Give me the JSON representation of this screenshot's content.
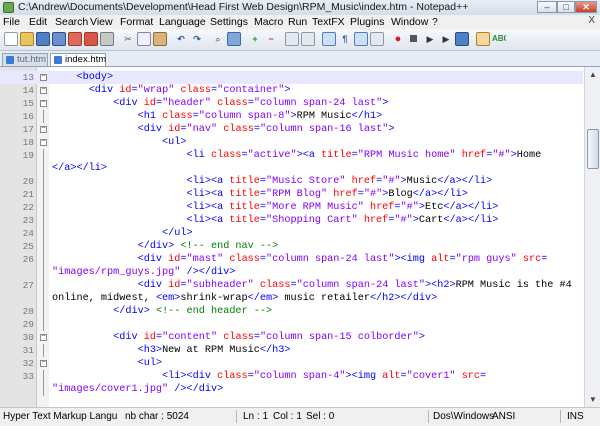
{
  "window": {
    "title": "C:\\Andrew\\Documents\\Development\\Head First Web Design\\RPM_Music\\index.htm - Notepad++",
    "min": "–",
    "max": "□",
    "close": "✕"
  },
  "menu": [
    "File",
    "Edit",
    "Search",
    "View",
    "Format",
    "Language",
    "Settings",
    "Macro",
    "Run",
    "TextFX",
    "Plugins",
    "Window",
    "?"
  ],
  "menu_close": "X",
  "toolbar": {
    "icons": [
      "new-file-icon",
      "open-file-icon",
      "save-icon",
      "save-all-icon",
      "close-icon",
      "close-all-icon",
      "print-icon",
      "cut-icon",
      "copy-icon",
      "paste-icon",
      "undo-icon",
      "redo-icon",
      "find-icon",
      "replace-icon",
      "zoom-in-icon",
      "zoom-out-icon",
      "sync-v-icon",
      "sync-h-icon",
      "wrap-icon",
      "all-chars-icon",
      "indent-guide-icon",
      "user-lang-icon",
      "record-macro-icon",
      "stop-record-icon",
      "play-macro-icon",
      "run-macro-multi-icon",
      "save-macro-icon",
      "tidy-icon",
      "spellcheck-icon"
    ]
  },
  "tabs": [
    {
      "label": "tut.htm"
    },
    {
      "label": "index.htm"
    }
  ],
  "editor": {
    "lines": [
      {
        "num": "13",
        "segs": [
          [
            "x",
            "    "
          ],
          [
            "t",
            "<body>"
          ]
        ]
      },
      {
        "num": "14",
        "segs": [
          [
            "x",
            "      "
          ],
          [
            "t",
            "<div "
          ],
          [
            "a",
            "id"
          ],
          [
            "t",
            "="
          ],
          [
            "s",
            "\"wrap\""
          ],
          [
            "t",
            " "
          ],
          [
            "a",
            "class"
          ],
          [
            "t",
            "="
          ],
          [
            "s",
            "\"container\""
          ],
          [
            "t",
            ">"
          ]
        ]
      },
      {
        "num": "15",
        "segs": [
          [
            "x",
            "          "
          ],
          [
            "t",
            "<div "
          ],
          [
            "a",
            "id"
          ],
          [
            "t",
            "="
          ],
          [
            "s",
            "\"header\""
          ],
          [
            "t",
            " "
          ],
          [
            "a",
            "class"
          ],
          [
            "t",
            "="
          ],
          [
            "s",
            "\"column span-24 last\""
          ],
          [
            "t",
            ">"
          ]
        ]
      },
      {
        "num": "16",
        "segs": [
          [
            "x",
            "              "
          ],
          [
            "t",
            "<h1 "
          ],
          [
            "a",
            "class"
          ],
          [
            "t",
            "="
          ],
          [
            "s",
            "\"column span-8\""
          ],
          [
            "t",
            ">"
          ],
          [
            "x",
            "RPM Music"
          ],
          [
            "t",
            "</h1>"
          ]
        ]
      },
      {
        "num": "17",
        "segs": [
          [
            "x",
            "              "
          ],
          [
            "t",
            "<div "
          ],
          [
            "a",
            "id"
          ],
          [
            "t",
            "="
          ],
          [
            "s",
            "\"nav\""
          ],
          [
            "t",
            " "
          ],
          [
            "a",
            "class"
          ],
          [
            "t",
            "="
          ],
          [
            "s",
            "\"column span-16 last\""
          ],
          [
            "t",
            ">"
          ]
        ]
      },
      {
        "num": "18",
        "segs": [
          [
            "x",
            "                  "
          ],
          [
            "t",
            "<ul>"
          ]
        ]
      },
      {
        "num": "19",
        "segs": [
          [
            "x",
            "                      "
          ],
          [
            "t",
            "<li "
          ],
          [
            "a",
            "class"
          ],
          [
            "t",
            "="
          ],
          [
            "s",
            "\"active\""
          ],
          [
            "t",
            "><a "
          ],
          [
            "a",
            "title"
          ],
          [
            "t",
            "="
          ],
          [
            "s",
            "\"RPM Music home\""
          ],
          [
            "t",
            " "
          ],
          [
            "a",
            "href"
          ],
          [
            "t",
            "="
          ],
          [
            "s",
            "\"#\""
          ],
          [
            "t",
            ">"
          ],
          [
            "x",
            "Home"
          ]
        ]
      },
      {
        "num": "",
        "segs": [
          [
            "t",
            "</a></li>"
          ]
        ]
      },
      {
        "num": "20",
        "segs": [
          [
            "x",
            "                      "
          ],
          [
            "t",
            "<li><a "
          ],
          [
            "a",
            "title"
          ],
          [
            "t",
            "="
          ],
          [
            "s",
            "\"Music Store\""
          ],
          [
            "t",
            " "
          ],
          [
            "a",
            "href"
          ],
          [
            "t",
            "="
          ],
          [
            "s",
            "\"#\""
          ],
          [
            "t",
            ">"
          ],
          [
            "x",
            "Music"
          ],
          [
            "t",
            "</a></li>"
          ]
        ]
      },
      {
        "num": "21",
        "segs": [
          [
            "x",
            "                      "
          ],
          [
            "t",
            "<li><a "
          ],
          [
            "a",
            "title"
          ],
          [
            "t",
            "="
          ],
          [
            "s",
            "\"RPM Blog\""
          ],
          [
            "t",
            " "
          ],
          [
            "a",
            "href"
          ],
          [
            "t",
            "="
          ],
          [
            "s",
            "\"#\""
          ],
          [
            "t",
            ">"
          ],
          [
            "x",
            "Blog"
          ],
          [
            "t",
            "</a></li>"
          ]
        ]
      },
      {
        "num": "22",
        "segs": [
          [
            "x",
            "                      "
          ],
          [
            "t",
            "<li><a "
          ],
          [
            "a",
            "title"
          ],
          [
            "t",
            "="
          ],
          [
            "s",
            "\"More RPM Music\""
          ],
          [
            "t",
            " "
          ],
          [
            "a",
            "href"
          ],
          [
            "t",
            "="
          ],
          [
            "s",
            "\"#\""
          ],
          [
            "t",
            ">"
          ],
          [
            "x",
            "Etc"
          ],
          [
            "t",
            "</a></li>"
          ]
        ]
      },
      {
        "num": "23",
        "segs": [
          [
            "x",
            "                      "
          ],
          [
            "t",
            "<li><a "
          ],
          [
            "a",
            "title"
          ],
          [
            "t",
            "="
          ],
          [
            "s",
            "\"Shopping Cart\""
          ],
          [
            "t",
            " "
          ],
          [
            "a",
            "href"
          ],
          [
            "t",
            "="
          ],
          [
            "s",
            "\"#\""
          ],
          [
            "t",
            ">"
          ],
          [
            "x",
            "Cart"
          ],
          [
            "t",
            "</a></li>"
          ]
        ]
      },
      {
        "num": "24",
        "segs": [
          [
            "x",
            "                  "
          ],
          [
            "t",
            "</ul>"
          ]
        ]
      },
      {
        "num": "25",
        "segs": [
          [
            "x",
            "              "
          ],
          [
            "t",
            "</div>"
          ],
          [
            "x",
            " "
          ],
          [
            "c",
            "<!-- end nav -->"
          ]
        ]
      },
      {
        "num": "26",
        "segs": [
          [
            "x",
            "              "
          ],
          [
            "t",
            "<div "
          ],
          [
            "a",
            "id"
          ],
          [
            "t",
            "="
          ],
          [
            "s",
            "\"mast\""
          ],
          [
            "t",
            " "
          ],
          [
            "a",
            "class"
          ],
          [
            "t",
            "="
          ],
          [
            "s",
            "\"column span-24 last\""
          ],
          [
            "t",
            "><img "
          ],
          [
            "a",
            "alt"
          ],
          [
            "t",
            "="
          ],
          [
            "s",
            "\"rpm guys\""
          ],
          [
            "t",
            " "
          ],
          [
            "a",
            "src"
          ],
          [
            "t",
            "="
          ]
        ]
      },
      {
        "num": "",
        "segs": [
          [
            "s",
            "\"images/rpm_guys.jpg\""
          ],
          [
            "t",
            " /></div>"
          ]
        ]
      },
      {
        "num": "27",
        "segs": [
          [
            "x",
            "              "
          ],
          [
            "t",
            "<div "
          ],
          [
            "a",
            "id"
          ],
          [
            "t",
            "="
          ],
          [
            "s",
            "\"subheader\""
          ],
          [
            "t",
            " "
          ],
          [
            "a",
            "class"
          ],
          [
            "t",
            "="
          ],
          [
            "s",
            "\"column span-24 last\""
          ],
          [
            "t",
            "><h2>"
          ],
          [
            "x",
            "RPM Music is the #4"
          ]
        ]
      },
      {
        "num": "",
        "segs": [
          [
            "x",
            "online, midwest, "
          ],
          [
            "t",
            "<em>"
          ],
          [
            "x",
            "shrink-wrap"
          ],
          [
            "t",
            "</em>"
          ],
          [
            "x",
            " music retailer"
          ],
          [
            "t",
            "</h2></div>"
          ]
        ]
      },
      {
        "num": "28",
        "segs": [
          [
            "x",
            "          "
          ],
          [
            "t",
            "</div>"
          ],
          [
            "x",
            " "
          ],
          [
            "c",
            "<!-- end header -->"
          ]
        ]
      },
      {
        "num": "29",
        "segs": [
          [
            "x",
            ""
          ]
        ]
      },
      {
        "num": "30",
        "segs": [
          [
            "x",
            "          "
          ],
          [
            "t",
            "<div "
          ],
          [
            "a",
            "id"
          ],
          [
            "t",
            "="
          ],
          [
            "s",
            "\"content\""
          ],
          [
            "t",
            " "
          ],
          [
            "a",
            "class"
          ],
          [
            "t",
            "="
          ],
          [
            "s",
            "\"column span-15 colborder\""
          ],
          [
            "t",
            ">"
          ]
        ]
      },
      {
        "num": "31",
        "segs": [
          [
            "x",
            "              "
          ],
          [
            "t",
            "<h3>"
          ],
          [
            "x",
            "New at RPM Music"
          ],
          [
            "t",
            "</h3>"
          ]
        ]
      },
      {
        "num": "32",
        "segs": [
          [
            "x",
            "              "
          ],
          [
            "t",
            "<ul>"
          ]
        ]
      },
      {
        "num": "33",
        "segs": [
          [
            "x",
            "                  "
          ],
          [
            "t",
            "<li><div "
          ],
          [
            "a",
            "class"
          ],
          [
            "t",
            "="
          ],
          [
            "s",
            "\"column span-4\""
          ],
          [
            "t",
            "><img "
          ],
          [
            "a",
            "alt"
          ],
          [
            "t",
            "="
          ],
          [
            "s",
            "\"cover1\""
          ],
          [
            "t",
            " "
          ],
          [
            "a",
            "src"
          ],
          [
            "t",
            "="
          ]
        ]
      },
      {
        "num": "",
        "segs": [
          [
            "s",
            "\"images/cover1.jpg\""
          ],
          [
            "t",
            " /></div>"
          ]
        ]
      }
    ]
  },
  "status": {
    "language": "Hyper Text Markup Langu",
    "chars": "nb char : 5024",
    "ln": "Ln : 1",
    "col": "Col : 1",
    "sel": "Sel : 0",
    "eol": "Dos\\Windows",
    "encoding": "ANSI",
    "mode": "INS"
  }
}
